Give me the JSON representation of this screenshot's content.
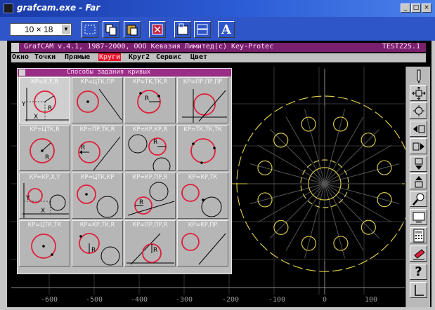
{
  "window": {
    "title": "grafcam.exe - Far",
    "controls": [
      "_",
      "□",
      "×"
    ]
  },
  "toolbar": {
    "font_size": "10 × 18",
    "icons": [
      "mark-icon",
      "copy-icon",
      "paste-icon",
      "fullscreen-icon",
      "properties-icon",
      "window-icon",
      "font-icon"
    ],
    "font_button": "A"
  },
  "app": {
    "caption": "GrafCAM v.4.1, 1987-2000, ООО Кевазия Лимитед(с) Key-Protec",
    "tag": "TESTZ25.1",
    "menu": [
      {
        "label": "Окно"
      },
      {
        "label": "Точки"
      },
      {
        "label": "Прямые"
      },
      {
        "label": "Круги",
        "active": true
      },
      {
        "label": "Круг2"
      },
      {
        "label": "Сервис"
      },
      {
        "label": "Цвет"
      }
    ]
  },
  "dialog": {
    "title": "Способы задания кривых",
    "cells": [
      {
        "label": "КР=X,Y,R"
      },
      {
        "label": "КР=ЦТК,ПР"
      },
      {
        "label": "КР=ТК,ТК,R"
      },
      {
        "label": "КР=ПР,ПР,ПР"
      },
      {
        "label": "КР=ЦТК,R"
      },
      {
        "label": "КР=ПР,ТК,R"
      },
      {
        "label": "КР=КР,КР,R"
      },
      {
        "label": "КР=ТК,ТК,ТК"
      },
      {
        "label": "КР=КР,X,Y"
      },
      {
        "label": "КР=ЦТК,КР"
      },
      {
        "label": "КР=КР,ПР,R"
      },
      {
        "label": "КР=КР,ТК"
      },
      {
        "label": "КР=ЦТК,ТК"
      },
      {
        "label": "КР=КР,ТК,R"
      },
      {
        "label": "КР=ПР,ПР,R"
      },
      {
        "label": "КР=КР,ПР"
      }
    ],
    "glyphs": {
      "radius": "R",
      "x": "X",
      "y": "Y"
    }
  },
  "axis": {
    "ticks": [
      "-600",
      "-500",
      "-400",
      "-300",
      "-200",
      "-100",
      "0",
      "100"
    ]
  },
  "right_tools": [
    "pen-icon",
    "zoom-fit-icon",
    "zoom-in-icon",
    "arrow-left-icon",
    "arrow-right-icon",
    "arrow-down-icon",
    "arrow-up-icon",
    "magnifier-icon",
    "monitor-icon",
    "calculator-icon",
    "eraser-icon",
    "help-icon",
    "corner-icon"
  ],
  "colors": {
    "curve": "#d8c84a",
    "highlight": "#e01f3a",
    "title": "#7a1f6e"
  }
}
